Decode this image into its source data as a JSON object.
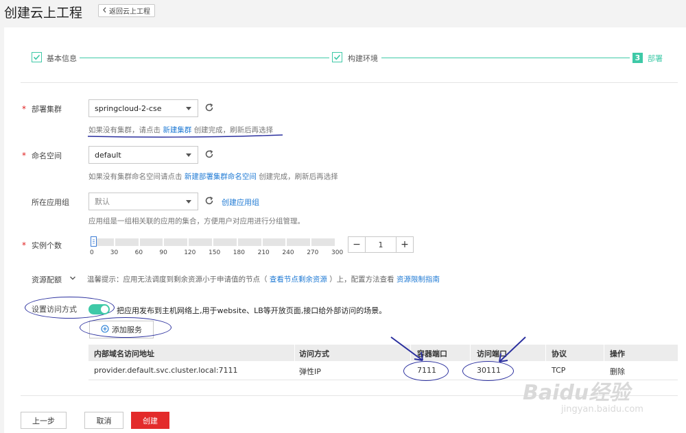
{
  "header": {
    "title": "创建云上工程",
    "back_label": "返回云上工程"
  },
  "steps": [
    {
      "label": "基本信息",
      "state": "done"
    },
    {
      "label": "构建环境",
      "state": "done"
    },
    {
      "number": "3",
      "label": "部署",
      "state": "current"
    }
  ],
  "cluster": {
    "label": "部署集群",
    "value": "springcloud-2-cse",
    "hint_prefix": "如果没有集群，请点击",
    "hint_link": "新建集群",
    "hint_suffix": "创建完成，刷新后再选择"
  },
  "namespace": {
    "label": "命名空间",
    "value": "default",
    "hint_prefix": "如果没有集群命名空间请点击",
    "hint_link": "新建部署集群命名空间",
    "hint_suffix": "创建完成，刷新后再选择"
  },
  "app_group": {
    "label": "所在应用组",
    "placeholder": "默认",
    "create_link": "创建应用组",
    "hint": "应用组是一组相关联的应用的集合，方便用户对应用进行分组管理。"
  },
  "instances": {
    "label": "实例个数",
    "ticks": [
      "0",
      "30",
      "60",
      "90",
      "120",
      "150",
      "180",
      "210",
      "240",
      "270",
      "300"
    ],
    "value": "1",
    "slider_fraction": 0.0033,
    "minus": "−",
    "plus": "+"
  },
  "resources": {
    "label": "资源配额",
    "tip_prefix": "温馨提示：应用无法调度到剩余资源小于申请值的节点（",
    "tip_link1": "查看节点剩余资源",
    "tip_middle": "）上，配置方法查看",
    "tip_link2": "资源限制指南"
  },
  "access": {
    "label": "设置访问方式",
    "enabled": true,
    "description": "把应用发布到主机网络上,用于website、LB等开放页面,接口给外部访问的场景。",
    "add_service": "添加服务"
  },
  "service_table": {
    "columns": [
      "内部域名访问地址",
      "访问方式",
      "容器端口",
      "访问端口",
      "协议",
      "操作"
    ],
    "rows": [
      [
        "provider.default.svc.cluster.local:7111",
        "弹性IP",
        "7111",
        "30111",
        "TCP",
        "删除"
      ]
    ]
  },
  "footer": {
    "prev": "上一步",
    "cancel": "取消",
    "create": "创建"
  },
  "watermark": {
    "text": "Baidu经验",
    "url": "jingyan.baidu.com"
  },
  "colors": {
    "accent": "#3ec9a7",
    "link": "#1f7ad4",
    "danger": "#e32b2b",
    "annotation": "#2a2f9e"
  }
}
